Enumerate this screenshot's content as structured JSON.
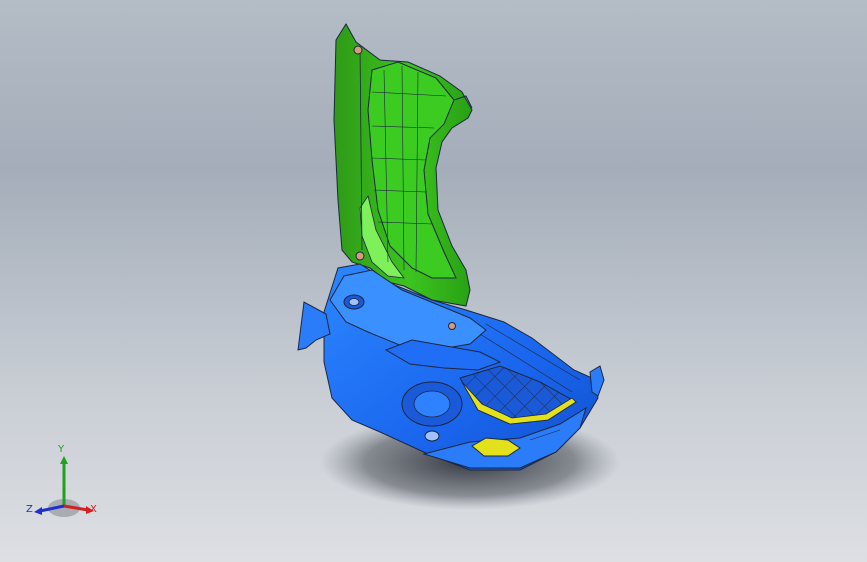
{
  "viewport": {
    "background_top": "#a4adb9",
    "background_bottom": "#dddfe3"
  },
  "model": {
    "upper_panel_color": "#33b11a",
    "lower_body_color": "#1e6cf5",
    "accent_color": "#e3e01c",
    "edge_color": "#1b2740"
  },
  "triad": {
    "x_label": "X",
    "y_label": "Y",
    "z_label": "Z",
    "x_color": "#d42020",
    "y_color": "#1fa01f",
    "z_color": "#2030d0"
  }
}
